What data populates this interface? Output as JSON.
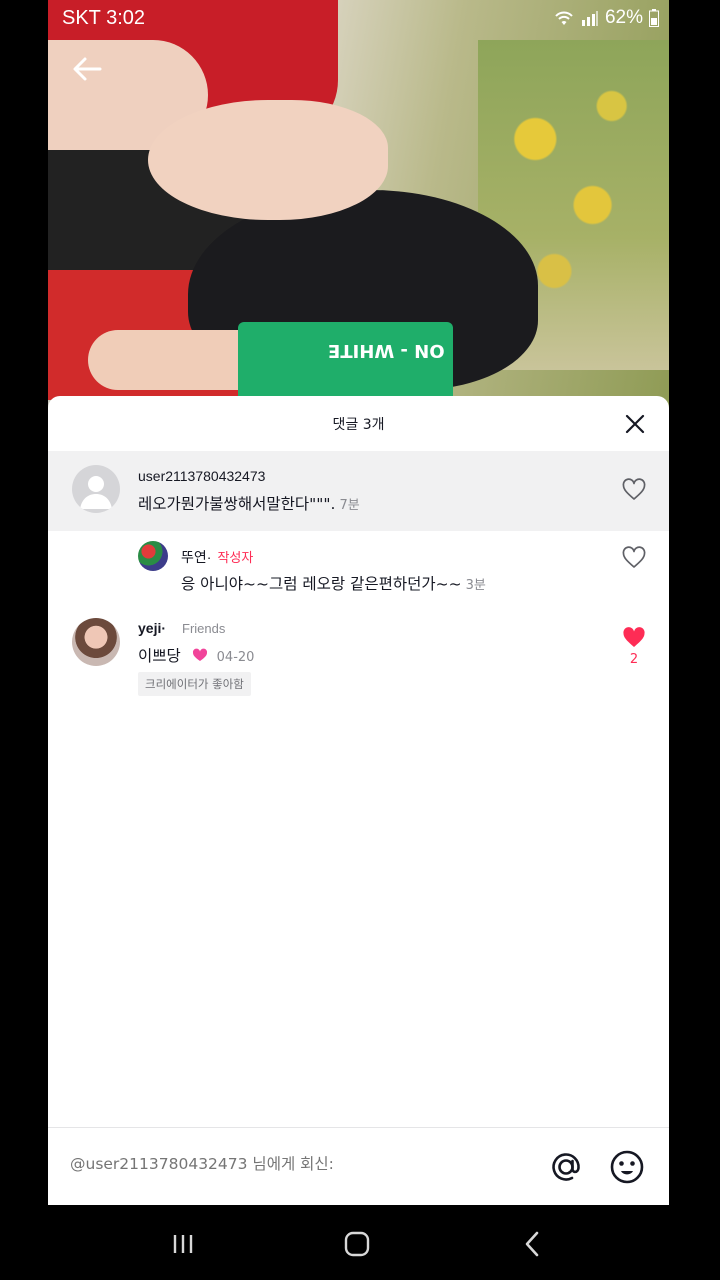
{
  "status_bar": {
    "carrier_time": "SKT 3:02",
    "battery": "62%"
  },
  "sheet": {
    "title": "댓글 3개",
    "close_icon": "close-icon"
  },
  "comments": [
    {
      "username": "user2113780432473",
      "text": "레오가뭔가불쌍해서말한다\"\"\".",
      "time": "7분",
      "liked": false,
      "highlighted": true
    },
    {
      "username": "뚜연·",
      "creator_label": "작성자",
      "text": "응 아니야~~그럼 레오랑 같은편하던가~~",
      "time": "3분",
      "liked": false
    },
    {
      "username": "yeji·",
      "friends_label": "Friends",
      "text": "이쁘당",
      "time": "04-20",
      "liked": true,
      "like_count": "2",
      "creator_liked_label": "크리에이터가 좋아함"
    }
  ],
  "reply_input": {
    "placeholder": "@user2113780432473 님에게 회신:"
  },
  "photo": {
    "card_text": "ON - WHITE"
  },
  "colors": {
    "accent": "#fe2c55",
    "text": "#161823",
    "muted": "#8a8b91"
  }
}
